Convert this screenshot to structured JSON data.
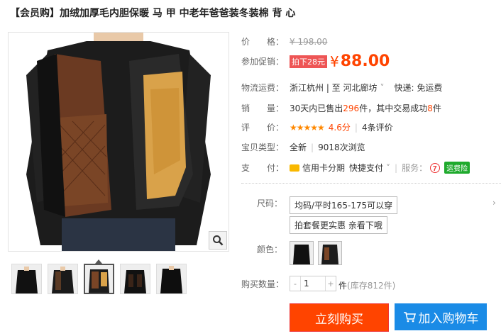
{
  "title": "【会员购】加绒加厚毛内胆保暖 马 甲 中老年爸爸装冬装棉 背 心",
  "price": {
    "label": "价　　格：",
    "original": "¥ 198.00"
  },
  "promo": {
    "label": "参加促销：",
    "tag": "拍下28元",
    "symbol": "¥",
    "value": "88.00"
  },
  "shipping": {
    "label": "物流运费：",
    "route": "浙江杭州 | 至  河北廊坊",
    "chevron": "˅",
    "fee": "快递: 免运费"
  },
  "sales": {
    "label": "销　　量：",
    "prefix": "30天内已售出",
    "sold": "296",
    "mid": "件，其中交易成功",
    "success": "8",
    "suffix": "件"
  },
  "rating": {
    "label": "评　　价：",
    "stars": "★★★★★",
    "score": "4.6分",
    "reviews": "4条评价"
  },
  "type": {
    "label": "宝贝类型：",
    "value": "全新",
    "views": "9018次浏览"
  },
  "payment": {
    "label": "支　　付：",
    "method1": "信用卡分期",
    "method2": "快捷支付",
    "chevron": "˅",
    "service_label": "服务：",
    "badge": "运费险"
  },
  "size": {
    "label": "尺码：",
    "options": [
      "均码/平时165-175可以穿",
      "拍套餐更实惠 亲看下哦"
    ]
  },
  "color": {
    "label": "颜色："
  },
  "quantity": {
    "label": "购买数量：",
    "value": "1",
    "unit": "件",
    "stock": "(库存812件)",
    "minus": "-",
    "plus": "+"
  },
  "buttons": {
    "buy": "立刻购买",
    "cart": "加入购物车"
  },
  "colors": {
    "accent": "#ff4400",
    "blue": "#1a8be6",
    "green": "#1faa2d"
  }
}
